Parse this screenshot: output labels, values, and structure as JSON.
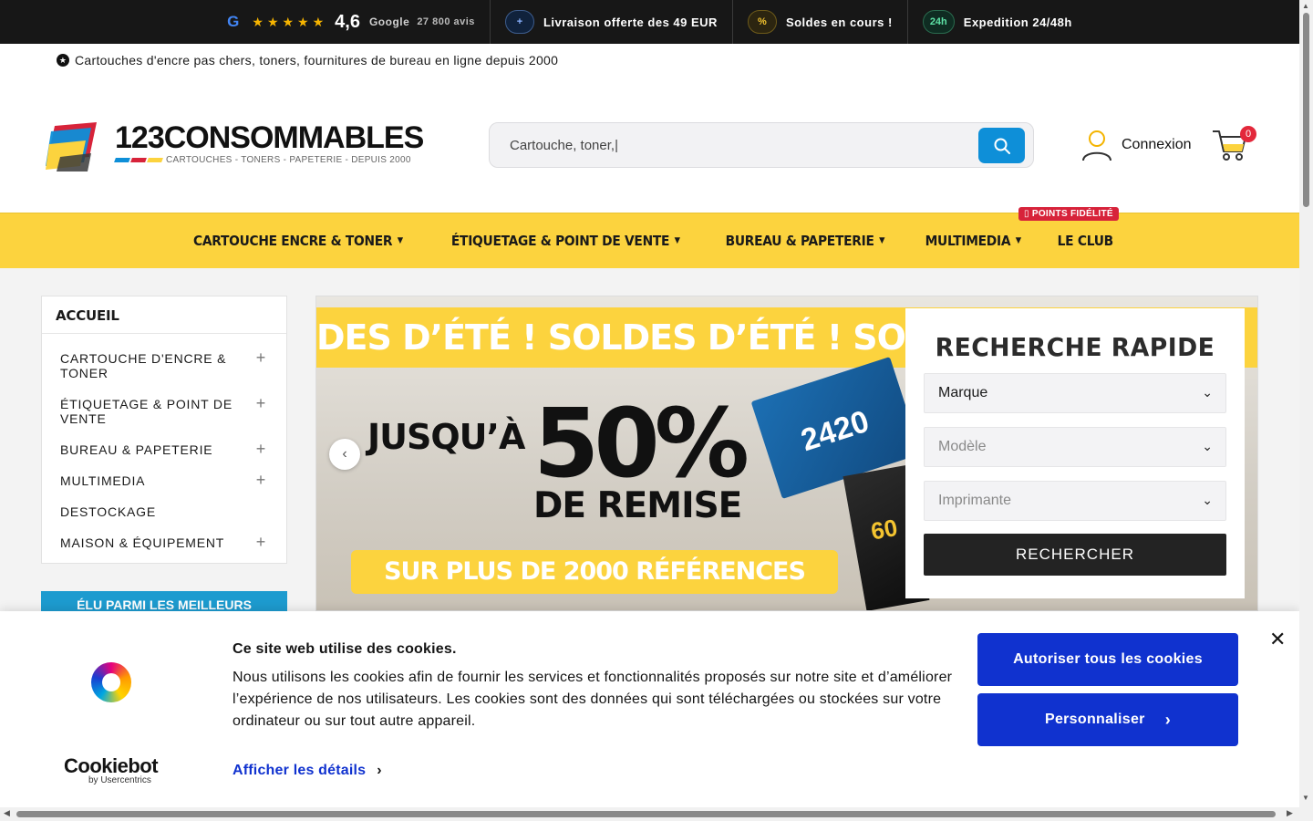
{
  "topbar": {
    "google_letter": "G",
    "stars": "★★★★★",
    "rating": "4,6",
    "google_label": "Google",
    "reviews": "27 800 avis",
    "shipping_pill": "+",
    "shipping_label": "Livraison offerte des 49 EUR",
    "sales_pill": "%",
    "sales_label": "Soldes en cours !",
    "expedition_pill": "24h",
    "expedition_label": "Expedition 24/48h"
  },
  "header": {
    "tagline": "Cartouches d'encre pas chers, toners, fournitures de bureau en ligne depuis 2000",
    "logo_name": "123CONSOMMABLES",
    "logo_sub": "CARTOUCHES - TONERS - PAPETERIE - DEPUIS 2000",
    "search_placeholder": "Cartouche, toner,|",
    "login_label": "Connexion",
    "cart_count": "0"
  },
  "nav": {
    "items": [
      {
        "label": "CARTOUCHE ENCRE & TONER"
      },
      {
        "label": "ÉTIQUETAGE & POINT DE VENTE"
      },
      {
        "label": "BUREAU & PAPETERIE"
      },
      {
        "label": "MULTIMEDIA"
      },
      {
        "label": "LE CLUB"
      }
    ],
    "club_badge": "▯ POINTS FIDÉLITÉ"
  },
  "sidebar": {
    "heading": "ACCUEIL",
    "items": [
      {
        "label": "CARTOUCHE D'ENCRE & TONER",
        "expand": "+"
      },
      {
        "label": "ÉTIQUETAGE & POINT DE VENTE",
        "expand": "+"
      },
      {
        "label": "BUREAU & PAPETERIE",
        "expand": "+"
      },
      {
        "label": "MULTIMEDIA",
        "expand": "+"
      },
      {
        "label": "DESTOCKAGE",
        "expand": ""
      },
      {
        "label": "MAISON & ÉQUIPEMENT",
        "expand": "+"
      }
    ],
    "banner": "ÉLU PARMI LES MEILLEURS"
  },
  "hero": {
    "stripe_text": "DES D’ÉTÉ !   SOLDES D’ÉTÉ !   SOLDES D’ÉTÉ !",
    "upto": "JUSQU’À",
    "percent": "50%",
    "remise": "DE REMISE",
    "references": "SUR PLUS DE 2000 RÉFÉRENCES",
    "box_blue_label": "2420",
    "box_dark_label": "60"
  },
  "quick_search": {
    "title": "RECHERCHE RAPIDE",
    "brand": "Marque",
    "model": "Modèle",
    "printer": "Imprimante",
    "button": "RECHERCHER"
  },
  "cookie": {
    "brand": "Cookiebot",
    "by": "by Usercentrics",
    "title": "Ce site web utilise des cookies.",
    "text": "Nous utilisons les cookies afin de fournir les services et fonctionnalités proposés sur notre site et d’améliorer l’expérience de nos utilisateurs. Les cookies sont des données qui sont téléchargées ou stockées sur votre ordinateur ou sur tout autre appareil.",
    "details_link": "Afficher les détails",
    "allow_all": "Autoriser tous les cookies",
    "customize": "Personnaliser",
    "close": "✕"
  },
  "colors": {
    "accent_yellow": "#fcd33e",
    "search_blue": "#0e8fd8",
    "cookie_blue": "#1032cf",
    "badge_red": "#e3283b"
  }
}
